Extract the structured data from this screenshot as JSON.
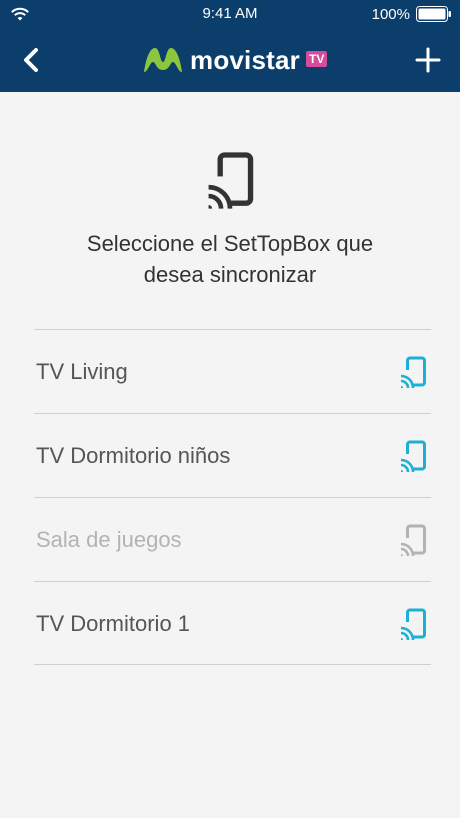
{
  "status_bar": {
    "time": "9:41 AM",
    "battery": "100%"
  },
  "nav": {
    "logo_text": "movistar",
    "logo_badge": "TV"
  },
  "main": {
    "prompt_line1": "Seleccione el SetTopBox que",
    "prompt_line2": "desea sincronizar"
  },
  "devices": [
    {
      "label": "TV Living",
      "enabled": true
    },
    {
      "label": "TV Dormitorio niños",
      "enabled": true
    },
    {
      "label": "Sala de juegos",
      "enabled": false
    },
    {
      "label": "TV Dormitorio 1",
      "enabled": true
    }
  ],
  "colors": {
    "header": "#0b3e6a",
    "accent": "#1ab0d8",
    "disabled": "#b3b3b3",
    "badge": "#d64b9a",
    "logo_green": "#8cc63f"
  },
  "icons": {
    "wifi": "wifi-icon",
    "battery": "battery-icon",
    "back": "chevron-left-icon",
    "add": "plus-icon",
    "cast": "cast-icon",
    "logo": "movistar-logo-icon"
  }
}
